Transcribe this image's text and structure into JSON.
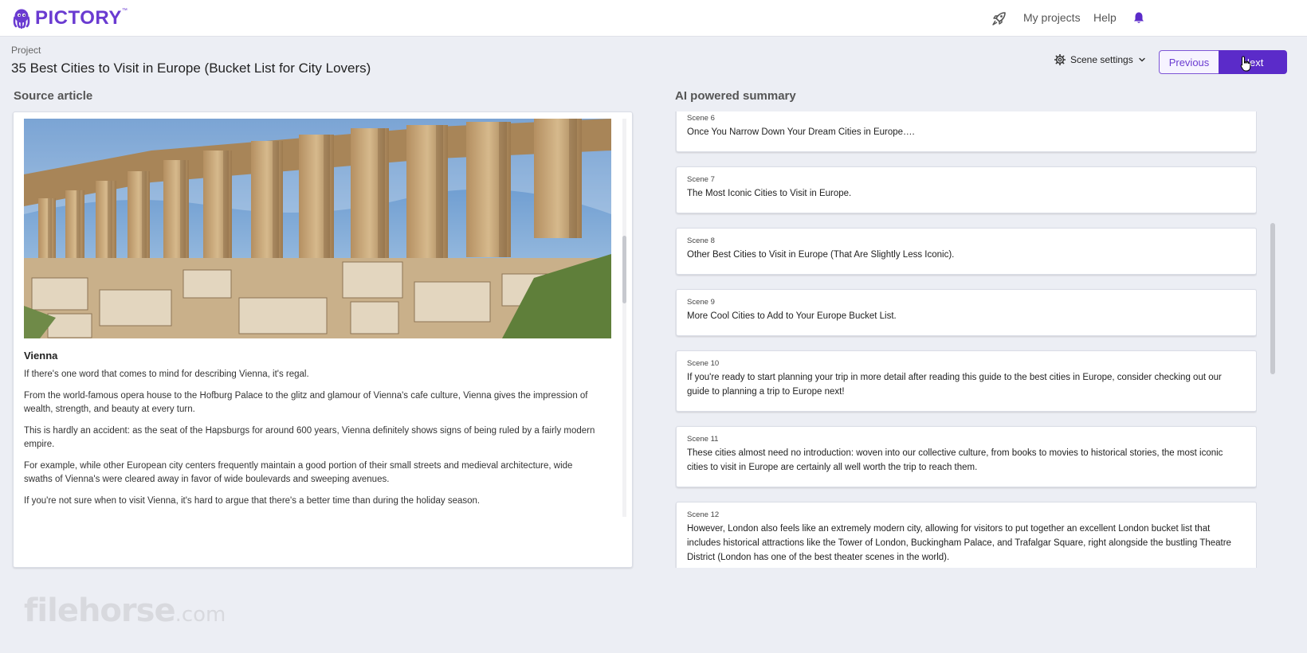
{
  "header": {
    "logo_text": "PICTORY",
    "logo_tm": "™",
    "brand_color": "#6a3bd1",
    "nav": {
      "projects": "My projects",
      "help": "Help"
    }
  },
  "project": {
    "label": "Project",
    "title": "35 Best Cities to Visit in Europe (Bucket List for City Lovers)"
  },
  "toolbar": {
    "scene_settings": "Scene settings",
    "previous": "Previous",
    "next": "Next"
  },
  "source": {
    "title": "Source article",
    "heading": "Vienna",
    "paragraphs": [
      "If there's one word that comes to mind for describing Vienna, it's regal.",
      "From the world-famous opera house to the Hofburg Palace to the glitz and glamour of Vienna's cafe culture, Vienna gives the impression of wealth, strength, and beauty at every turn.",
      "This is hardly an accident: as the seat of the Hapsburgs for around 600 years, Vienna definitely shows signs of being ruled by a fairly modern empire.",
      "For example, while other European city centers frequently maintain a good portion of their small streets and medieval architecture, wide swaths of Vienna's were cleared away in favor of wide boulevards and sweeping avenues.",
      "If you're not sure when to visit Vienna, it's hard to argue that there's a better time than during the holiday season."
    ]
  },
  "summary": {
    "title": "AI powered summary",
    "scenes": [
      {
        "num": "Scene 6",
        "text": "Once You Narrow Down Your Dream Cities in Europe…."
      },
      {
        "num": "Scene 7",
        "text": "The Most Iconic Cities to Visit in Europe."
      },
      {
        "num": "Scene 8",
        "text": "Other Best Cities to Visit in Europe (That Are Slightly Less Iconic)."
      },
      {
        "num": "Scene 9",
        "text": "More Cool Cities to Add to Your Europe Bucket List."
      },
      {
        "num": "Scene 10",
        "text": "If you're ready to start planning your trip in more detail after reading this guide to the best cities in Europe, consider checking out our guide to planning a trip to Europe next!"
      },
      {
        "num": "Scene 11",
        "text": "These cities almost need no introduction: woven into our collective culture, from books to movies to historical stories, the most iconic cities to visit in Europe are certainly all well worth the trip to reach them."
      },
      {
        "num": "Scene 12",
        "text": "However, London also feels like an extremely modern city, allowing for visitors to put together an excellent London bucket list that includes historical attractions like the Tower of London, Buckingham Palace, and Trafalgar Square, right alongside the bustling Theatre District (London has one of the best theater scenes in the world)."
      }
    ]
  },
  "watermark": {
    "main": "filehorse",
    "suffix": ".com"
  },
  "icons": [
    "octopus-logo-icon",
    "rocket-icon",
    "bell-icon",
    "gear-icon",
    "chevron-down-icon",
    "cursor-icon"
  ]
}
